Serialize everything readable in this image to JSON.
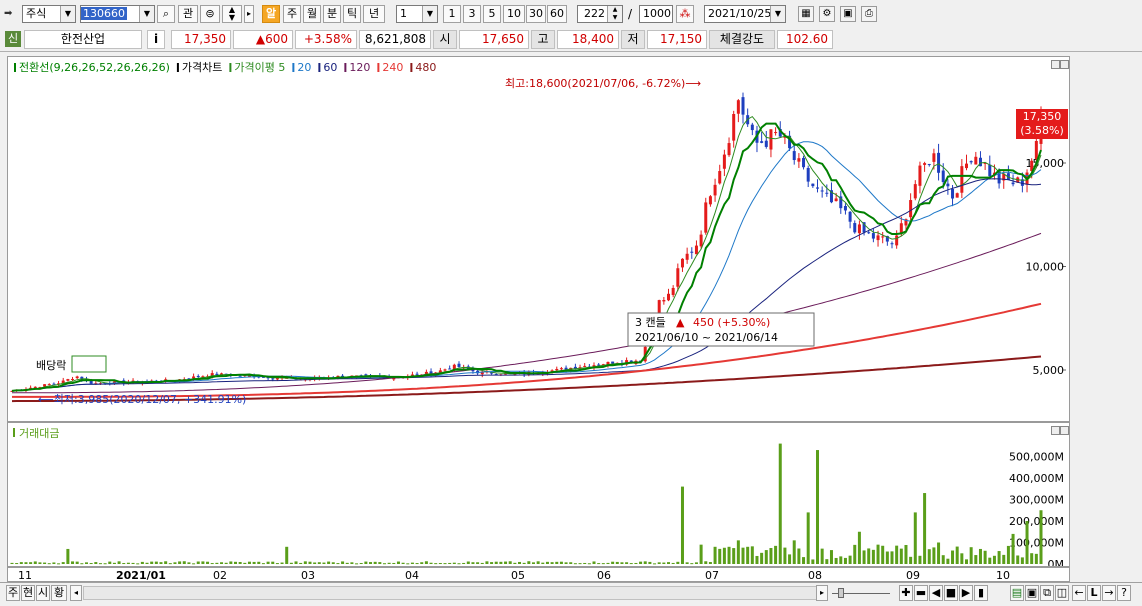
{
  "toolbar": {
    "market_type": "주식",
    "stock_code": "130660",
    "btn_search": "⌕",
    "btn_gwan": "관",
    "btn_al": "알",
    "periods": [
      "주",
      "월",
      "분",
      "틱",
      "년"
    ],
    "interval_value": "1",
    "quick_intervals": [
      "1",
      "3",
      "5",
      "10",
      "30",
      "60"
    ],
    "display_count": "222",
    "slash": "/",
    "total_count": "1000",
    "date": "2021/10/25"
  },
  "quote": {
    "badge": "신",
    "name": "한전산업",
    "info_btn": "i",
    "price": "17,350",
    "change": "▲600",
    "change_rate": "+3.58%",
    "volume": "8,621,808",
    "open_label": "시",
    "open": "17,650",
    "high_label": "고",
    "high": "18,400",
    "low_label": "저",
    "low": "17,150",
    "strength_label": "체결강도",
    "strength": "102.60"
  },
  "price_panel": {
    "legend": [
      {
        "text": "전환선(9,26,26,52,26,26,26)",
        "color": "#008000"
      },
      {
        "text": "가격차트",
        "color": "#000000"
      },
      {
        "text": "가격이평 5",
        "color": "#2e8b20"
      },
      {
        "text": "20",
        "color": "#1e78c8"
      },
      {
        "text": "60",
        "color": "#1a237e"
      },
      {
        "text": "120",
        "color": "#6a1b5a"
      },
      {
        "text": "240",
        "color": "#e53935"
      },
      {
        "text": "480",
        "color": "#8b1a1a"
      }
    ],
    "high_annotation": "최고:18,600(2021/07/06, -6.72%)⟶",
    "low_annotation": "⟵최저:3,985(2020/12/07, +341.91%)",
    "dividend_label": "배당락",
    "tooltip": {
      "line1_prefix": "3 캔들",
      "line1_arrow": "▲",
      "line1_value": "450 (+5.30%)",
      "line2": "2021/06/10 ~ 2021/06/14"
    },
    "current_price_tag": "17,350",
    "current_rate_tag": "(3.58%)",
    "y_ticks": [
      {
        "label": "15,000",
        "value": 15000
      },
      {
        "label": "10,000",
        "value": 10000
      },
      {
        "label": "5,000",
        "value": 5000
      }
    ]
  },
  "volume_panel": {
    "legend": "거래대금",
    "y_ticks": [
      {
        "label": "500,000M",
        "value": 500000
      },
      {
        "label": "400,000M",
        "value": 400000
      },
      {
        "label": "300,000M",
        "value": 300000
      },
      {
        "label": "200,000M",
        "value": 200000
      },
      {
        "label": "100,000M",
        "value": 100000
      },
      {
        "label": "0M",
        "value": 0
      }
    ]
  },
  "x_axis": {
    "labels": [
      "11",
      "2021/01",
      "02",
      "03",
      "04",
      "05",
      "06",
      "07",
      "08",
      "09",
      "10"
    ]
  },
  "bottom_bar": {
    "tabs": [
      "주",
      "현",
      "시",
      "황"
    ]
  }
}
